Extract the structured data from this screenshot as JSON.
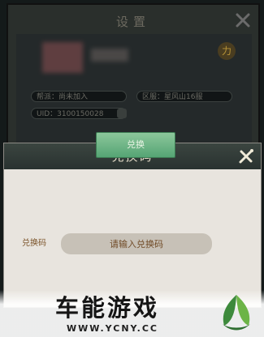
{
  "background_window": {
    "title": "设置",
    "fields": [
      {
        "label": "帮派：尚未加入"
      },
      {
        "label": "区服：星风山16服"
      },
      {
        "label": "UID：3100150028"
      }
    ],
    "badge": "力"
  },
  "dialog": {
    "title": "兑换码",
    "code_label": "兑换码",
    "input_placeholder": "请输入兑换码",
    "redeem_label": "兑换"
  },
  "watermark": {
    "text": "车能游戏",
    "url": "WWW.YCNY.CC"
  },
  "colors": {
    "header": "#2f3a36",
    "panel": "#e8e4de",
    "button": "#67b082",
    "label": "#7a5228"
  }
}
